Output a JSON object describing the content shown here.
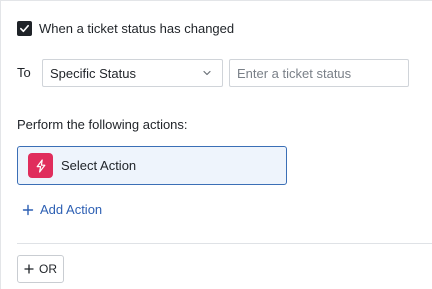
{
  "trigger": {
    "checked": true,
    "label": "When a ticket status has changed"
  },
  "condition": {
    "to_label": "To",
    "status_select_value": "Specific Status",
    "status_input_placeholder": "Enter a ticket status",
    "status_input_value": ""
  },
  "actions": {
    "heading": "Perform the following actions:",
    "select_action_label": "Select Action",
    "action_icon": "lightning-icon",
    "action_icon_color": "#e02d5c",
    "add_action_label": "Add Action"
  },
  "footer": {
    "or_button_label": "OR"
  },
  "colors": {
    "link": "#2c5fb3",
    "selected_border": "#3b6fb6",
    "selected_bg": "#eef4fc"
  }
}
